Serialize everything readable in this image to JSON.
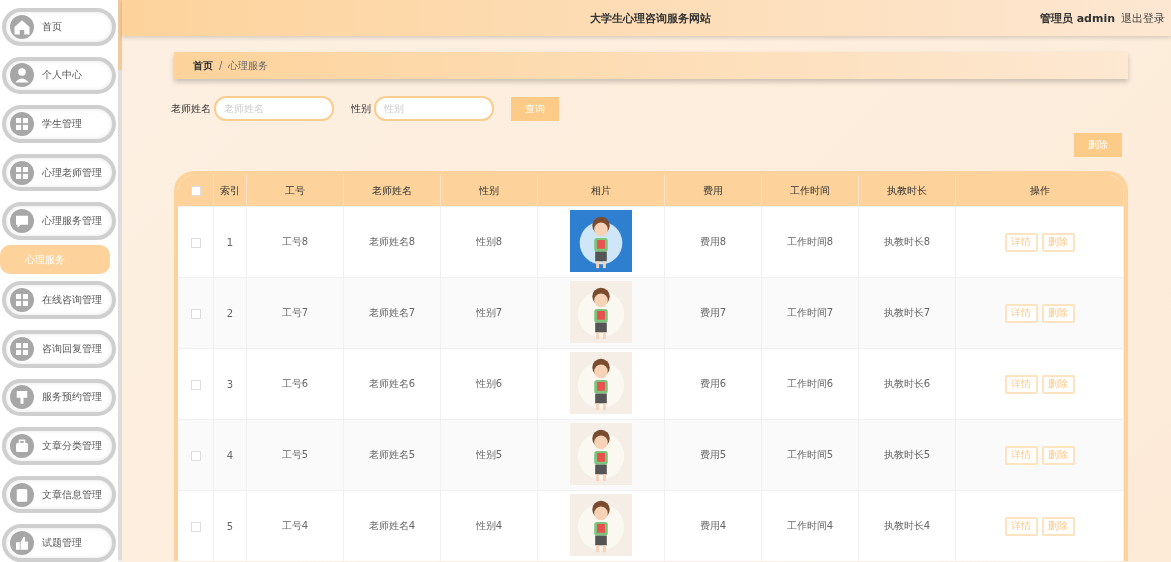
{
  "header": {
    "title": "大学生心理咨询服务网站",
    "user": "管理员 admin",
    "logout": "退出登录"
  },
  "sidebar": {
    "items": [
      {
        "label": "首页",
        "selected": false
      },
      {
        "label": "个人中心",
        "selected": false
      },
      {
        "label": "学生管理",
        "selected": false
      },
      {
        "label": "心理老师管理",
        "selected": false
      },
      {
        "label": "心理服务管理",
        "selected": false,
        "children": [
          {
            "label": "心理服务",
            "selected": true
          }
        ]
      },
      {
        "label": "在线咨询管理",
        "selected": false
      },
      {
        "label": "咨询回复管理",
        "selected": false
      },
      {
        "label": "服务预约管理",
        "selected": false
      },
      {
        "label": "文章分类管理",
        "selected": false
      },
      {
        "label": "文章信息管理",
        "selected": false
      },
      {
        "label": "试题管理",
        "selected": false
      }
    ]
  },
  "breadcrumb": {
    "items": [
      "首页",
      "心理服务"
    ],
    "separator": "/"
  },
  "search": {
    "fields": [
      {
        "label": "老师姓名",
        "placeholder": "老师姓名"
      },
      {
        "label": "性别",
        "placeholder": "性别"
      }
    ],
    "button": "查询"
  },
  "delete_button": "删除",
  "table": {
    "select_all_checked": false,
    "columns": [
      "索引",
      "工号",
      "老师姓名",
      "性别",
      "相片",
      "费用",
      "工作时间",
      "执教时长",
      "操作"
    ],
    "rows": [
      {
        "checked": false,
        "cells": [
          "1",
          "工号8",
          "老师姓名8",
          "性别8",
          {
            "kind": "picture"
          },
          "费用8",
          "工作时间8",
          "执教时长8",
          {
            "kind": "actions",
            "buttons": [
              "详情",
              "删除"
            ]
          }
        ]
      },
      {
        "checked": false,
        "cells": [
          "2",
          "工号7",
          "老师姓名7",
          "性别7",
          {
            "kind": "picture"
          },
          "费用7",
          "工作时间7",
          "执教时长7",
          {
            "kind": "actions",
            "buttons": [
              "详情",
              "删除"
            ]
          }
        ]
      },
      {
        "checked": false,
        "cells": [
          "3",
          "工号6",
          "老师姓名6",
          "性别6",
          {
            "kind": "picture"
          },
          "费用6",
          "工作时间6",
          "执教时长6",
          {
            "kind": "actions",
            "buttons": [
              "详情",
              "删除"
            ]
          }
        ]
      },
      {
        "checked": false,
        "cells": [
          "4",
          "工号5",
          "老师姓名5",
          "性别5",
          {
            "kind": "picture"
          },
          "费用5",
          "工作时间5",
          "执教时长5",
          {
            "kind": "actions",
            "buttons": [
              "详情",
              "删除"
            ]
          }
        ]
      },
      {
        "checked": false,
        "cells": [
          "5",
          "工号4",
          "老师姓名4",
          "性别4",
          {
            "kind": "picture"
          },
          "费用4",
          "工作时间4",
          "执教时长4",
          {
            "kind": "actions",
            "buttons": [
              "详情",
              "删除"
            ]
          }
        ]
      }
    ]
  }
}
